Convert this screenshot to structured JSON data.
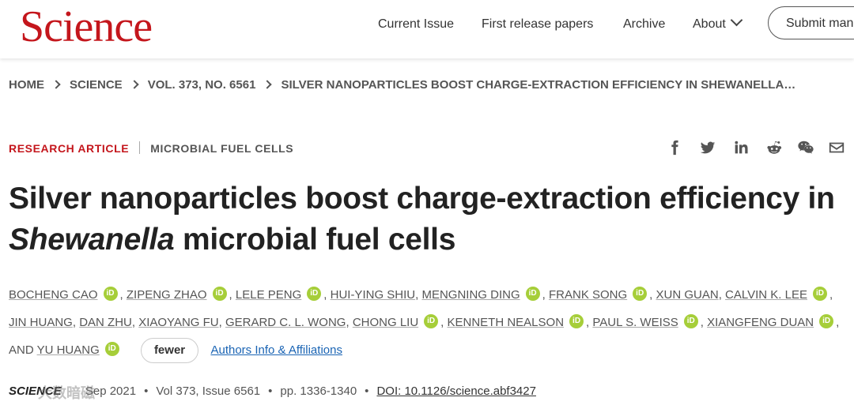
{
  "header": {
    "logo": "Science",
    "nav": [
      "Current Issue",
      "First release papers",
      "Archive",
      "About"
    ],
    "submit": "Submit man"
  },
  "breadcrumb": [
    "HOME",
    "SCIENCE",
    "VOL. 373, NO. 6561",
    "SILVER NANOPARTICLES BOOST CHARGE-EXTRACTION EFFICIENCY IN SHEWANELLA…"
  ],
  "article": {
    "type": "RESEARCH ARTICLE",
    "section": "MICROBIAL FUEL CELLS",
    "title_part1": "Silver nanoparticles boost charge-extraction efficiency in ",
    "title_italic": "Shewanella",
    "title_part2": " microbial fuel cells",
    "share_icons": [
      "facebook-icon",
      "twitter-icon",
      "linkedin-icon",
      "reddit-icon",
      "wechat-icon",
      "email-icon"
    ],
    "authors": [
      "BOCHENG CAO",
      "ZIPENG ZHAO",
      "LELE PENG",
      "HUI-YING SHIU",
      "MENGNING DING",
      "FRANK SONG",
      "XUN GUAN",
      "CALVIN K. LEE",
      "JIN HUANG",
      "DAN ZHU",
      "XIAOYANG FU",
      "GERARD C. L. WONG",
      "CHONG LIU",
      "KENNETH NEALSON",
      "PAUL S. WEISS",
      "XIANGFENG DUAN",
      "YU HUANG"
    ],
    "orcid_label": "iD",
    "and_word": "AND",
    "fewer": "fewer",
    "affiliations": "Authors Info & Affiliations",
    "meta": {
      "journal": "SCIENCE",
      "date": "Sep 2021",
      "volume": "Vol 373, Issue 6561",
      "pages": "pp. 1336-1340",
      "doi": "DOI: 10.1126/science.abf3427"
    },
    "watermark": "大数暗磁"
  },
  "colors": {
    "brand": "#c4161c",
    "orcid": "#a6ce39",
    "link": "#1a64b4"
  }
}
